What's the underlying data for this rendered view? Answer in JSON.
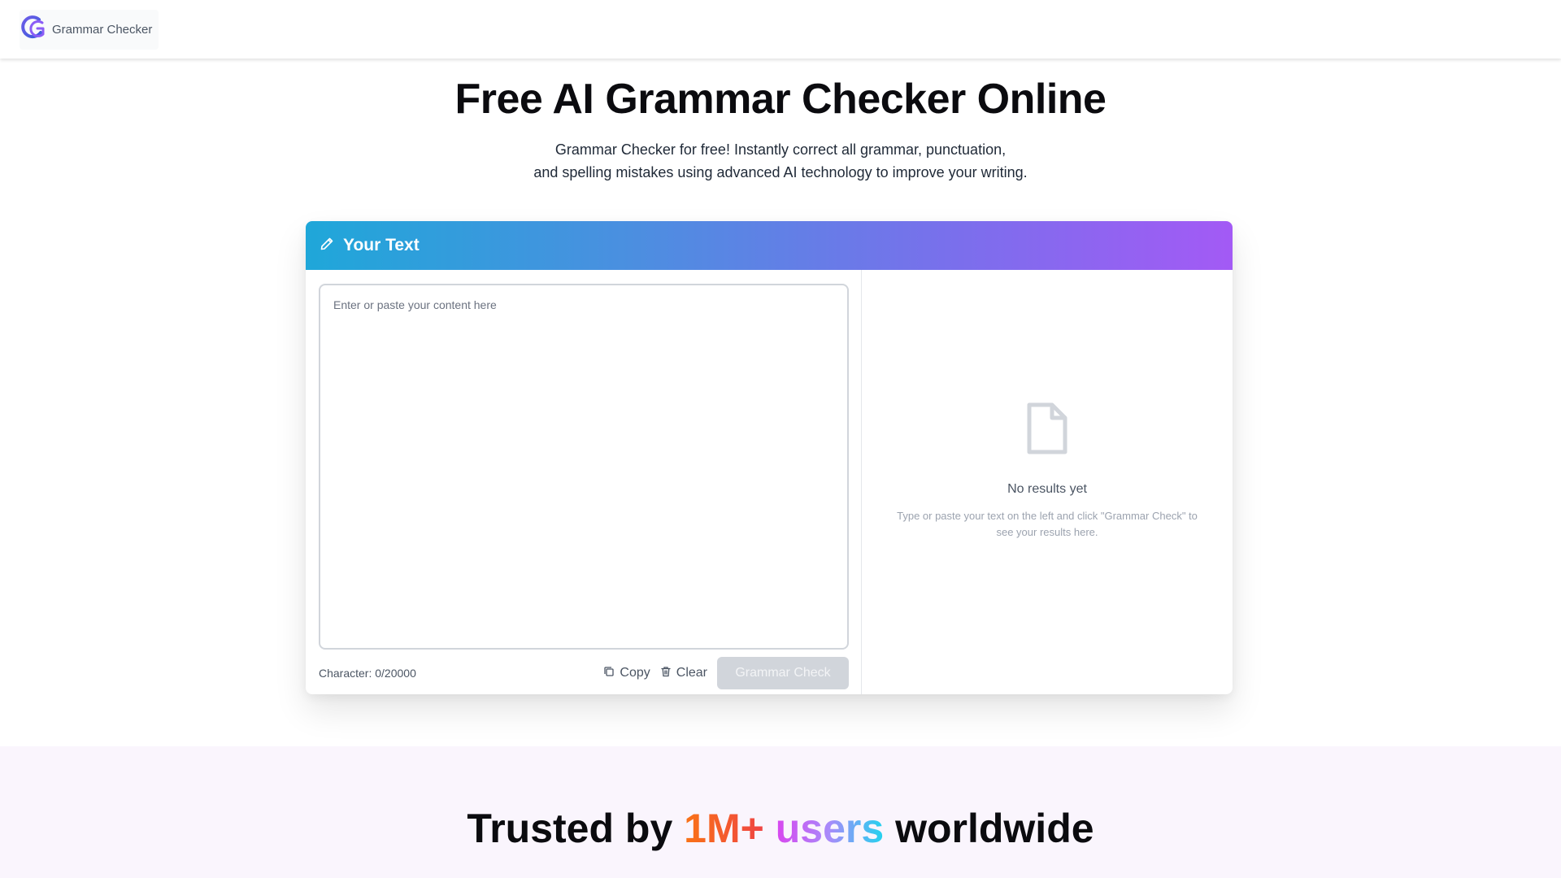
{
  "header": {
    "logo_text": "Grammar Checker",
    "logo_icon": "gc-logo-icon"
  },
  "hero": {
    "title": "Free AI Grammar Checker Online",
    "subtitle_line1": "Grammar Checker for free! Instantly correct all grammar, punctuation,",
    "subtitle_line2": "and spelling mistakes using advanced AI technology to improve your writing."
  },
  "editor": {
    "header_icon": "pencil-icon",
    "header_title": "Your Text",
    "placeholder": "Enter or paste your content here",
    "value": "",
    "char_count": "Character: 0/20000",
    "copy_label": "Copy",
    "clear_label": "Clear",
    "check_label": "Grammar Check",
    "check_enabled": false
  },
  "results": {
    "icon": "document-icon",
    "title": "No results yet",
    "hint": "Type or paste your text on the left and click \"Grammar Check\" to see your results here."
  },
  "trusted": {
    "prefix": "Trusted by",
    "highlight_count": "1M+",
    "highlight_users": "users",
    "suffix": "worldwide"
  },
  "colors": {
    "header_gradient_start": "#1fa7d9",
    "header_gradient_end": "#a35af5",
    "disabled_button": "#d1d5db",
    "trusted_bg": "#faf5fd"
  }
}
